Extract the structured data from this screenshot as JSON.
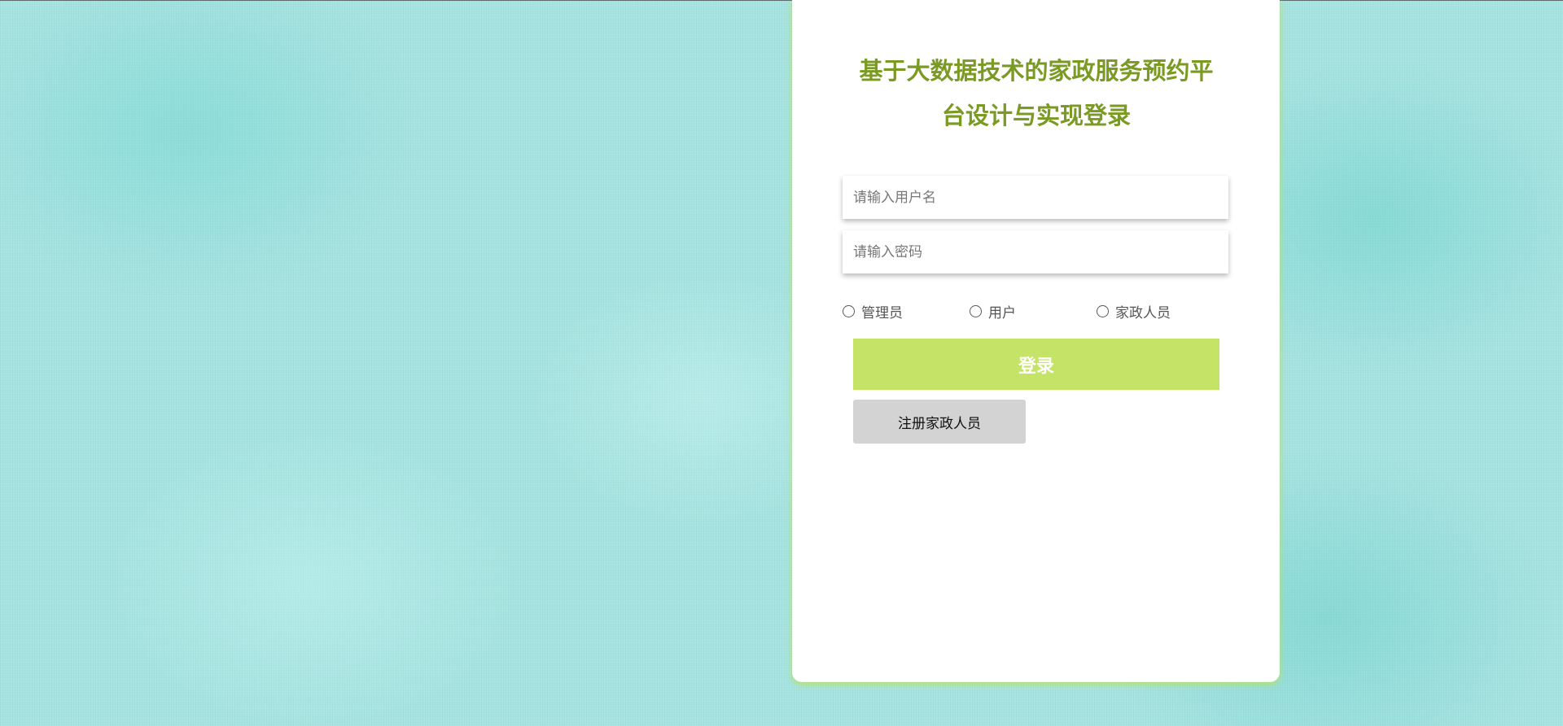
{
  "login": {
    "title": "基于大数据技术的家政服务预约平台设计与实现登录",
    "username": {
      "placeholder": "请输入用户名",
      "value": ""
    },
    "password": {
      "placeholder": "请输入密码",
      "value": ""
    },
    "roles": [
      {
        "label": "管理员",
        "selected": false
      },
      {
        "label": "用户",
        "selected": false
      },
      {
        "label": "家政人员",
        "selected": false
      }
    ],
    "login_button": "登录",
    "register_button": "注册家政人员"
  },
  "colors": {
    "background": "#a7e3e0",
    "title": "#7a9a23",
    "login_button": "#c5e366",
    "register_button": "#d3d3d3",
    "panel_glow": "#b9e15a"
  }
}
